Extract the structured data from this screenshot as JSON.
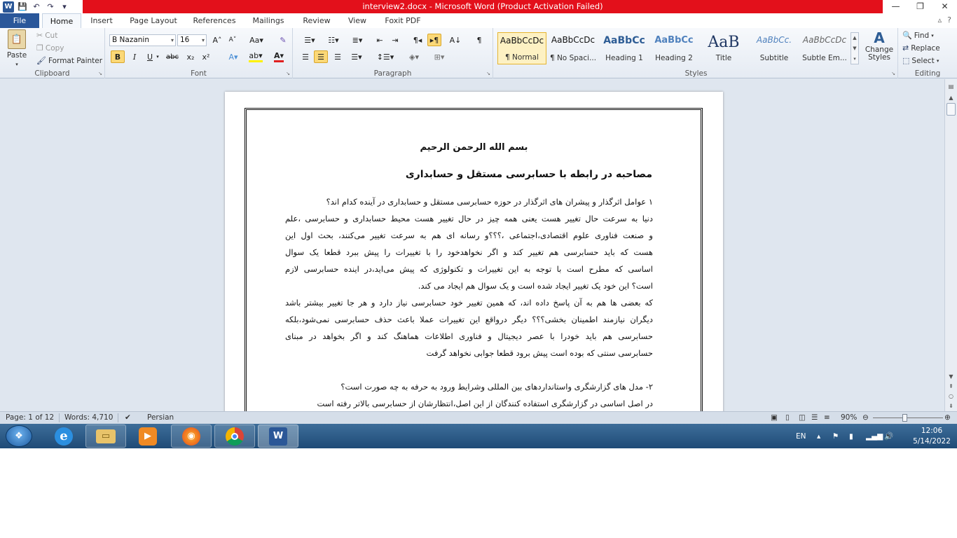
{
  "window": {
    "title": "interview2.docx  -  Microsoft Word (Product Activation Failed)",
    "app_logo": "W",
    "controls": {
      "minimize": "—",
      "maximize": "❐",
      "close": "✕"
    }
  },
  "tabs": [
    "File",
    "Home",
    "Insert",
    "Page Layout",
    "References",
    "Mailings",
    "Review",
    "View",
    "Foxit PDF"
  ],
  "ribbon": {
    "clipboard": {
      "label": "Clipboard",
      "paste": "Paste",
      "cut": "Cut",
      "copy": "Copy",
      "format_painter": "Format Painter"
    },
    "font": {
      "label": "Font",
      "font_name": "B Nazanin",
      "font_size": "16"
    },
    "paragraph": {
      "label": "Paragraph"
    },
    "styles": {
      "label": "Styles",
      "items": [
        {
          "sample": "AaBbCcDc",
          "name": "¶ Normal"
        },
        {
          "sample": "AaBbCcDc",
          "name": "¶ No Spaci..."
        },
        {
          "sample": "AaBbCc",
          "name": "Heading 1"
        },
        {
          "sample": "AaBbCc",
          "name": "Heading 2"
        },
        {
          "sample": "AaB",
          "name": "Title"
        },
        {
          "sample": "AaBbCc.",
          "name": "Subtitle"
        },
        {
          "sample": "AaBbCcDc",
          "name": "Subtle Em..."
        }
      ],
      "change_styles": "Change Styles"
    },
    "editing": {
      "label": "Editing",
      "find": "Find",
      "replace": "Replace",
      "select": "Select"
    }
  },
  "document": {
    "title1": "بسم الله الرحمن الرحیم",
    "title2": "مصاحبه در رابطه با حسابرسی مستقل و حسابداری",
    "lines": [
      "۱   عوامل اثرگذار و پیشران های اثرگذار در حوزه حسابرسی مستقل و حسابداری در آینده کدام اند؟",
      "دنیا به سرعت حال تغییر هست یعنی همه چیز در حال تغییر هست محیط حسابداری و حسابرسی ،علم",
      "و صنعت  فناوری علوم اقتصادی،اجتماعی ،؟؟؟و رسانه ای هم به سرعت تغییر می‌کنند، بحث اول این",
      "هست که باید حسابرسی هم تغییر کند و اگر نخواهدخود را با تغییرات را پیش ببرد قطعا یک سوال",
      "اساسی که مطرح است با توجه به این تغییرات و تکنولوژی که پیش می‌اید،در اینده حسابرسی لازم",
      "است؟ این خود یک تغییر ایجاد شده است و یک سوال هم  ایجاد می کند.",
      "که بعضی ها هم به آن پاسخ داده اند، که همین تغییر خود حسابرسی نیاز دارد و هر جا تغییر بیشتر باشد",
      "دیگران نیازمند اطمینان بخشی؟؟؟ دیگر درواقع این تغییرات عملا باعث حذف حسابرسی نمی‌شود،بلکه",
      "حسابرسی هم باید خودرا با عصر دیجیتال و فناوری اطلاعات هماهنگ کند و اگر بخواهد در مبنای",
      "حسابرسی سنتی که بوده است پیش برود قطعا جوابی نخواهد گرفت",
      "",
      "۲- مدل های گزارشگری واستاندارد‌های بین المللی وشرایط ورود به حرفه به چه صورت است؟",
      "در اصل اساسی در گزارشگری استفاده کنندگان از این اصل،انتظارشان از حسابرسی بالاتر رفته است"
    ]
  },
  "statusbar": {
    "page": "Page: 1 of 12",
    "words": "Words: 4,710",
    "language": "Persian",
    "zoom": "90%",
    "zoom_level": 0.45
  },
  "taskbar": {
    "tray_lang": "EN",
    "time": "12:06",
    "date": "5/14/2022"
  }
}
